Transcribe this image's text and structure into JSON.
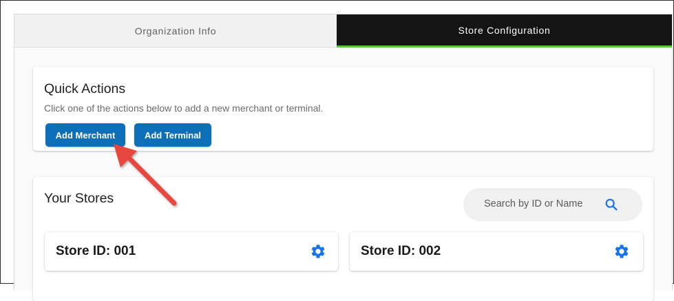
{
  "tabs": [
    {
      "label": "Organization Info",
      "active": false
    },
    {
      "label": "Store Configuration",
      "active": true
    }
  ],
  "quick_actions": {
    "title": "Quick Actions",
    "description": "Click one of the actions below to add a new merchant or terminal.",
    "add_merchant_label": "Add Merchant",
    "add_terminal_label": "Add Terminal"
  },
  "stores": {
    "title": "Your Stores",
    "search": {
      "placeholder": "Search by ID or Name",
      "icon": "search-icon"
    },
    "items": [
      {
        "label": "Store ID: 001",
        "icon": "gear-icon"
      },
      {
        "label": "Store ID: 002",
        "icon": "gear-icon"
      }
    ]
  },
  "colors": {
    "primary_button": "#0d6fb8",
    "active_tab_bg": "#141414",
    "active_tab_underline": "#5cc23c",
    "icon_blue": "#1a73e8",
    "annotation_arrow": "#e8473f"
  }
}
